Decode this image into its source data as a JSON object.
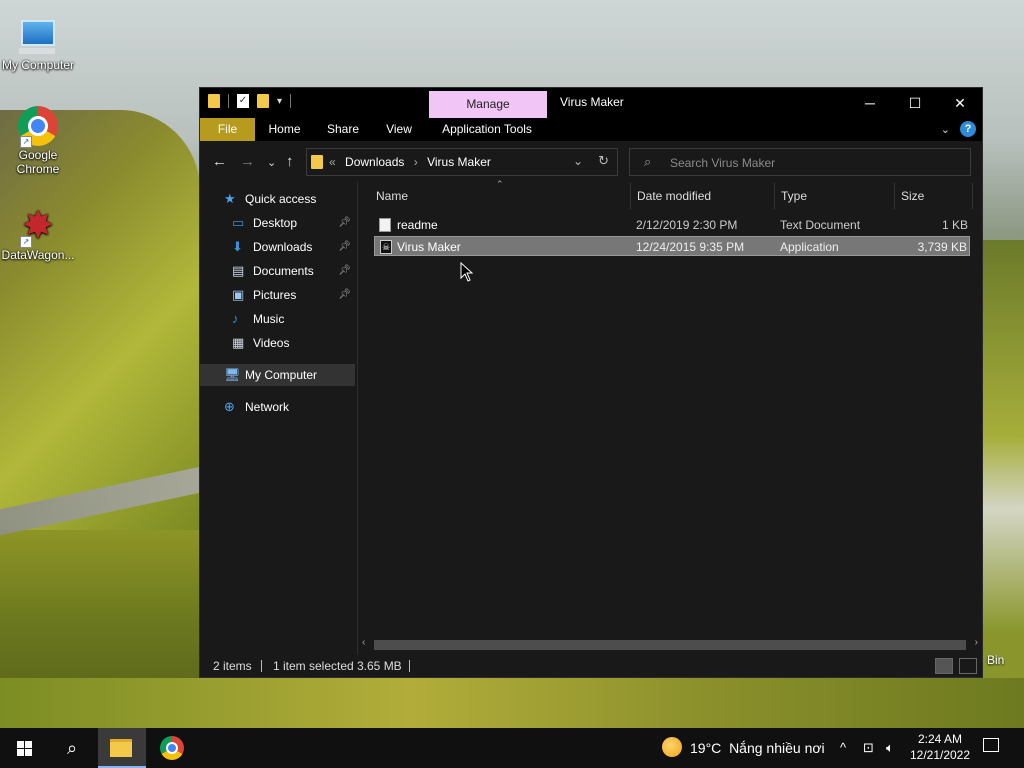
{
  "desktop": {
    "icons": [
      {
        "label": "My Computer"
      },
      {
        "label": "Google Chrome"
      },
      {
        "label": "DataWagon..."
      }
    ],
    "recycle_label": "Bin"
  },
  "window": {
    "title": "Virus Maker",
    "manage_tab": "Manage",
    "ribbon_tabs": [
      "File",
      "Home",
      "Share",
      "View",
      "Application Tools"
    ],
    "address": {
      "overflow": "«",
      "crumbs": [
        "Downloads",
        "Virus Maker"
      ]
    },
    "search": {
      "placeholder": "Search Virus Maker"
    },
    "nav": [
      {
        "label": "Quick access",
        "icon": "star-icon"
      },
      {
        "label": "Desktop",
        "icon": "desktop-icon",
        "pinned": true
      },
      {
        "label": "Downloads",
        "icon": "download-icon",
        "pinned": true
      },
      {
        "label": "Documents",
        "icon": "document-icon",
        "pinned": true
      },
      {
        "label": "Pictures",
        "icon": "picture-icon",
        "pinned": true
      },
      {
        "label": "Music",
        "icon": "music-icon"
      },
      {
        "label": "Videos",
        "icon": "video-icon"
      },
      {
        "label": "My Computer",
        "icon": "computer-icon",
        "selected": true
      },
      {
        "label": "Network",
        "icon": "network-icon"
      }
    ],
    "columns": {
      "name": "Name",
      "date": "Date modified",
      "type": "Type",
      "size": "Size"
    },
    "files": [
      {
        "name": "readme",
        "date": "2/12/2019 2:30 PM",
        "type": "Text Document",
        "size": "1 KB"
      },
      {
        "name": "Virus Maker",
        "date": "12/24/2015 9:35 PM",
        "type": "Application",
        "size": "3,739 KB",
        "selected": true
      }
    ],
    "status": {
      "count": "2 items",
      "selection": "1 item selected",
      "size": "3.65 MB"
    }
  },
  "taskbar": {
    "weather": {
      "temp": "19°C",
      "desc": "Nắng nhiều nơi"
    },
    "clock": {
      "time": "2:24 AM",
      "date": "12/21/2022"
    }
  },
  "colors": {
    "accent": "#b79b1f",
    "manage": "#f1c5f5",
    "selection": "#777777"
  }
}
